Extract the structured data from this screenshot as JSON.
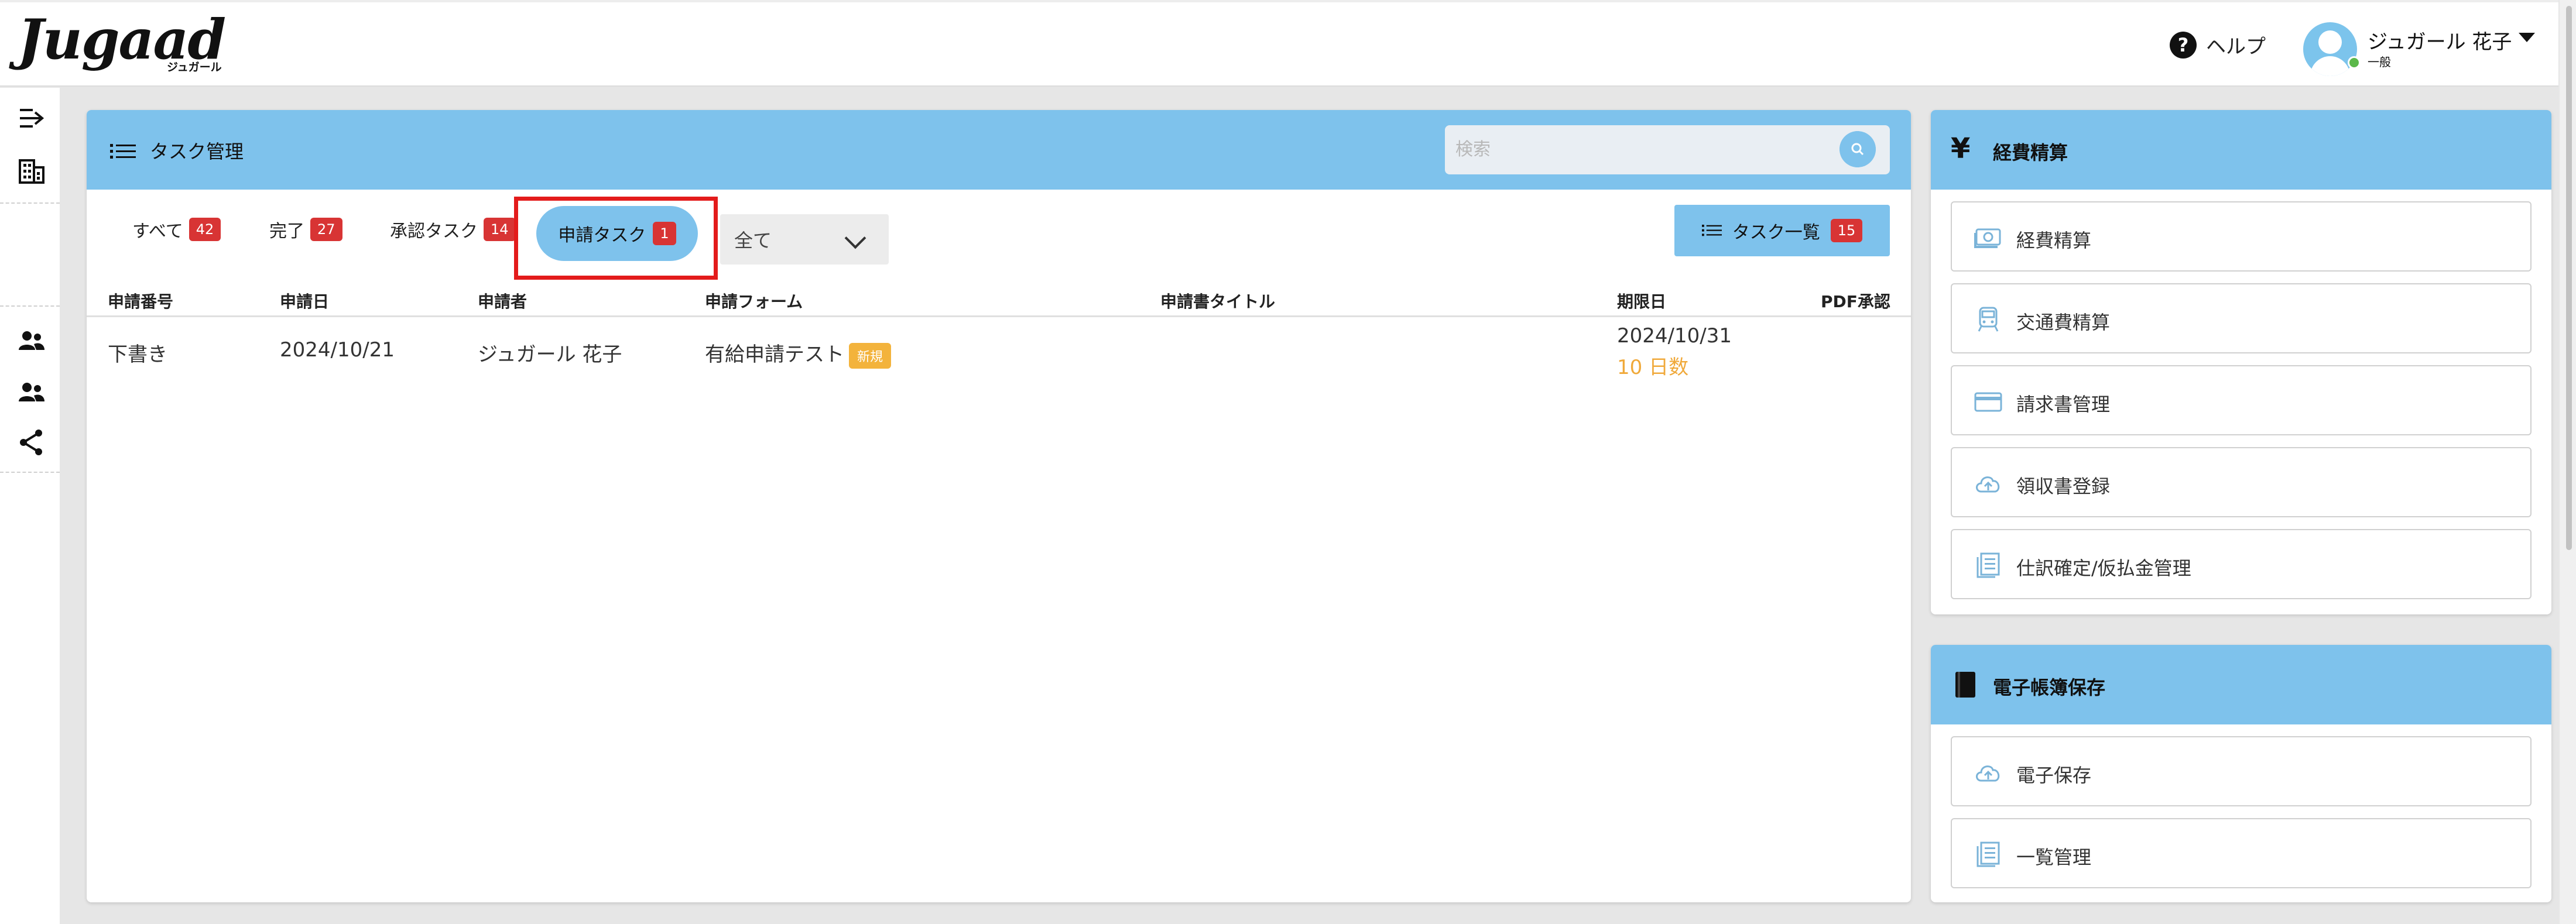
{
  "header": {
    "logo_text": "Jugaad",
    "logo_sub": "ジュガール",
    "help_label": "ヘルプ",
    "user_name": "ジュガール 花子",
    "user_role": "一般"
  },
  "task_panel": {
    "title": "タスク管理",
    "search_placeholder": "検索",
    "tabs": [
      {
        "label": "すべて",
        "count": "42"
      },
      {
        "label": "完了",
        "count": "27"
      },
      {
        "label": "承認タスク",
        "count": "14"
      },
      {
        "label": "申請タスク",
        "count": "1"
      }
    ],
    "filter_value": "全て",
    "task_list_button": {
      "label": "タスク一覧",
      "count": "15"
    },
    "columns": [
      "申請番号",
      "申請日",
      "申請者",
      "申請フォーム",
      "申請書タイトル",
      "期限日",
      "PDF承認"
    ],
    "rows": [
      {
        "number": "下書き",
        "date": "2024/10/21",
        "applicant": "ジュガール 花子",
        "form": "有給申請テスト",
        "form_tag": "新規",
        "title": "",
        "due_date": "2024/10/31",
        "due_days": "10 日数",
        "pdf": ""
      }
    ]
  },
  "expense_panel": {
    "title": "経費精算",
    "icon": "yen-icon",
    "items": [
      {
        "label": "経費精算",
        "icon": "money-icon"
      },
      {
        "label": "交通費精算",
        "icon": "train-icon"
      },
      {
        "label": "請求書管理",
        "icon": "card-icon"
      },
      {
        "label": "領収書登録",
        "icon": "cloud-upload-icon"
      },
      {
        "label": "仕訳確定/仮払金管理",
        "icon": "document-list-icon"
      }
    ]
  },
  "storage_panel": {
    "title": "電子帳簿保存",
    "icon": "book-icon",
    "items": [
      {
        "label": "電子保存",
        "icon": "cloud-upload-icon"
      },
      {
        "label": "一覧管理",
        "icon": "document-list-icon"
      }
    ]
  },
  "colors": {
    "accent": "#7ec2ec",
    "badge": "#d83434",
    "new_tag": "#f3b33c",
    "highlight": "#e31b1b"
  }
}
